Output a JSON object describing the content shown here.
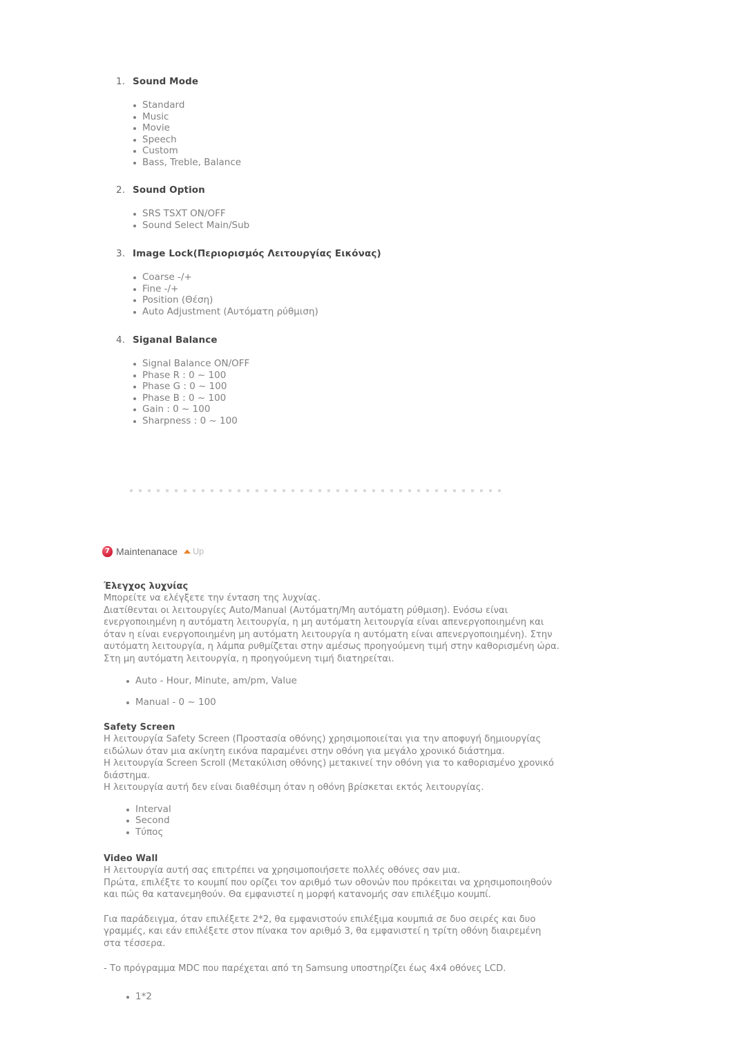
{
  "controls": {
    "groups": [
      {
        "number": "1.",
        "title": "Sound Mode",
        "items": [
          "Standard",
          "Music",
          "Movie",
          "Speech",
          "Custom",
          "Bass, Treble, Balance"
        ]
      },
      {
        "number": "2.",
        "title": "Sound Option",
        "items": [
          "SRS TSXT ON/OFF",
          "Sound Select Main/Sub"
        ]
      },
      {
        "number": "3.",
        "title": "Image Lock(Περιορισμός Λειτουργίας Εικόνας)",
        "items": [
          "Coarse -/+",
          "Fine -/+",
          "Position (Θέση)",
          "Auto Adjustment (Αυτόματη ρύθμιση)"
        ]
      },
      {
        "number": "4.",
        "title": "Siganal Balance",
        "items": [
          "Signal Balance ON/OFF",
          "Phase R : 0 ~ 100",
          "Phase G : 0 ~ 100",
          "Phase B : 0 ~ 100",
          "Gain : 0 ~ 100",
          "Sharpness : 0 ~ 100"
        ]
      }
    ]
  },
  "maintenance": {
    "badge_number": "7",
    "title": "Maintenanace",
    "up_label": "Up",
    "sections": [
      {
        "title": "Έλεγχος λυχνίας",
        "paragraphs": [
          "Μπορείτε να ελέγξετε την ένταση της λυχνίας.",
          "Διατίθενται οι λειτουργίες Auto/Manual (Αυτόματη/Μη αυτόματη ρύθμιση). Ενόσω είναι ενεργοποιημένη η αυτόματη λειτουργία, η μη αυτόματη λειτουργία είναι απενεργοποιημένη και όταν η είναι ενεργοποιημένη μη αυτόματη λειτουργία η αυτόματη είναι απενεργοποιημένη). Στην αυτόματη λειτουργία, η λάμπα ρυθμίζεται στην αμέσως προηγούμενη τιμή στην καθορισμένη ώρα. Στη μη αυτόματη λειτουργία, η προηγούμενη τιμή διατηρείται."
        ],
        "items": [
          "Auto - Hour, Minute, am/pm, Value",
          "Manual - 0 ~ 100"
        ]
      },
      {
        "title": "Safety Screen",
        "paragraphs": [
          "Η λειτουργία Safety Screen (Προστασία οθόνης) χρησιμοποιείται για την αποφυγή δημιουργίας ειδώλων όταν μια ακίνητη εικόνα παραμένει στην οθόνη για μεγάλο χρονικό διάστημα.",
          "Η λειτουργία Screen Scroll (Μετακύλιση οθόνης) μετακινεί την οθόνη για το καθορισμένο χρονικό διάστημα.",
          "Η λειτουργία αυτή δεν είναι διαθέσιμη όταν η οθόνη βρίσκεται εκτός λειτουργίας."
        ],
        "items": [
          "Interval",
          "Second",
          "Τύπος"
        ]
      },
      {
        "title": "Video Wall",
        "paragraphs": [
          "Η λειτουργία αυτή σας επιτρέπει να χρησιμοποιήσετε πολλές οθόνες σαν μια.",
          "Πρώτα, επιλέξτε το κουμπί που ορίζει τον αριθμό των οθονών που πρόκειται να χρησιμοποιηθούν και πώς θα κατανεμηθούν. Θα εμφανιστεί η μορφή κατανομής σαν επιλέξιμο κουμπί."
        ],
        "extra_paragraphs": [
          "Για παράδειγμα, όταν επιλέξετε 2*2, θα εμφανιστούν επιλέξιμα κουμπιά σε δυο σειρές και δυο γραμμές, και εάν επιλέξετε στον πίνακα τον αριθμό 3, θα εμφανιστεί η τρίτη οθόνη διαιρεμένη στα τέσσερα."
        ],
        "note": "- Το πρόγραμμα MDC που παρέχεται από τη Samsung υποστηρίζει έως 4x4 οθόνες LCD.",
        "items": [
          "1*2"
        ]
      }
    ]
  }
}
